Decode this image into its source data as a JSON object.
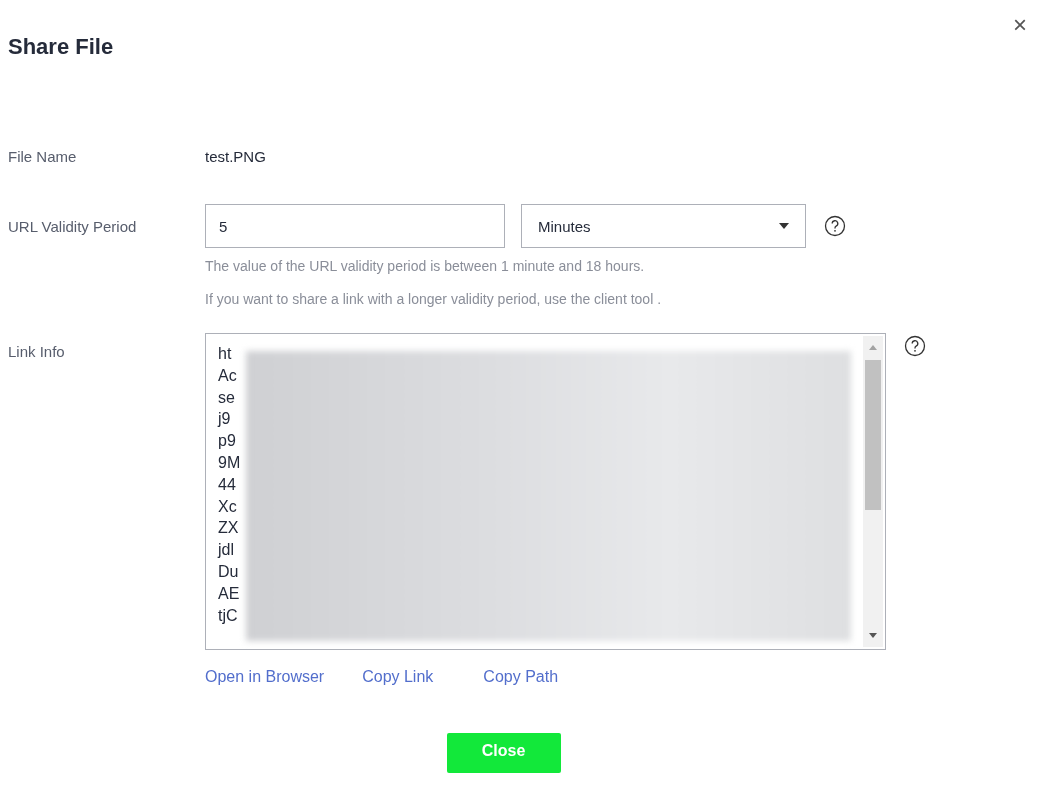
{
  "dialog": {
    "title": "Share File",
    "close_icon": "×"
  },
  "file_name": {
    "label": "File Name",
    "value": "test.PNG"
  },
  "validity": {
    "label": "URL Validity Period",
    "value": "5",
    "unit": "Minutes",
    "hints": [
      "The value of the URL validity period is between 1 minute and 18 hours.",
      "If you want to share a link with a longer validity period, use the client tool ."
    ]
  },
  "link_info": {
    "label": "Link Info",
    "lines": [
      "ht",
      "Ac",
      "se",
      "j9",
      "p9",
      "9M",
      "44",
      "Xc",
      "ZX",
      "jdl",
      "Du",
      "AE",
      "tjC"
    ]
  },
  "links": [
    "Open in Browser",
    "Copy Link",
    "Copy Path"
  ],
  "buttons": [
    "Close"
  ]
}
